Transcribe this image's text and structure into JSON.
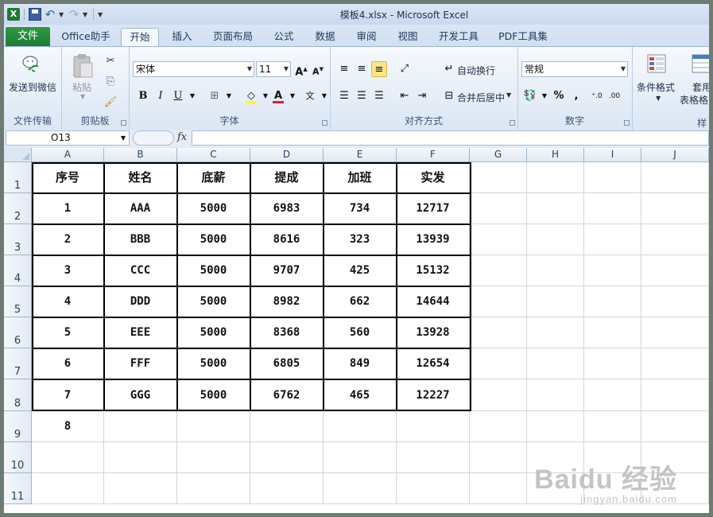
{
  "window": {
    "title": "模板4.xlsx - Microsoft Excel"
  },
  "quick_access": {
    "icons": [
      "excel-app-icon",
      "save-icon",
      "undo-icon",
      "redo-icon"
    ]
  },
  "tabs": {
    "file": "文件",
    "items": [
      "Office助手",
      "开始",
      "插入",
      "页面布局",
      "公式",
      "数据",
      "审阅",
      "视图",
      "开发工具",
      "PDF工具集"
    ],
    "active": "开始"
  },
  "ribbon": {
    "wechat": {
      "label": "发送到微信",
      "group": "文件传输"
    },
    "clipboard": {
      "paste": "粘贴",
      "group": "剪贴板"
    },
    "font": {
      "name": "宋体",
      "size": "11",
      "bold": "B",
      "italic": "I",
      "underline": "U",
      "group": "字体",
      "font_color": "#e02020",
      "fill_color": "#ffff00"
    },
    "alignment": {
      "wrap": "自动换行",
      "merge": "合并后居中",
      "group": "对齐方式"
    },
    "number": {
      "format": "常规",
      "percent": "%",
      "comma": ",",
      "group": "数字"
    },
    "styles": {
      "conditional": "条件格式",
      "table_line1": "套用",
      "table_line2": "表格格",
      "group_partial": "样"
    }
  },
  "formula_bar": {
    "name_box": "O13",
    "fx": "fx",
    "formula": ""
  },
  "sheet": {
    "columns": [
      "A",
      "B",
      "C",
      "D",
      "E",
      "F",
      "G",
      "H",
      "I",
      "J"
    ],
    "rows": [
      "1",
      "2",
      "3",
      "4",
      "5",
      "6",
      "7",
      "8",
      "9",
      "10",
      "11"
    ],
    "header": [
      "序号",
      "姓名",
      "底薪",
      "提成",
      "加班",
      "实发"
    ],
    "data": [
      [
        "1",
        "AAA",
        "5000",
        "6983",
        "734",
        "12717"
      ],
      [
        "2",
        "BBB",
        "5000",
        "8616",
        "323",
        "13939"
      ],
      [
        "3",
        "CCC",
        "5000",
        "9707",
        "425",
        "15132"
      ],
      [
        "4",
        "DDD",
        "5000",
        "8982",
        "662",
        "14644"
      ],
      [
        "5",
        "EEE",
        "5000",
        "8368",
        "560",
        "13928"
      ],
      [
        "6",
        "FFF",
        "5000",
        "6805",
        "849",
        "12654"
      ],
      [
        "7",
        "GGG",
        "5000",
        "6762",
        "465",
        "12227"
      ]
    ],
    "extra": {
      "A9": "8"
    }
  },
  "watermark": {
    "main": "Baidu 经验",
    "sub": "jingyan.baidu.com"
  }
}
